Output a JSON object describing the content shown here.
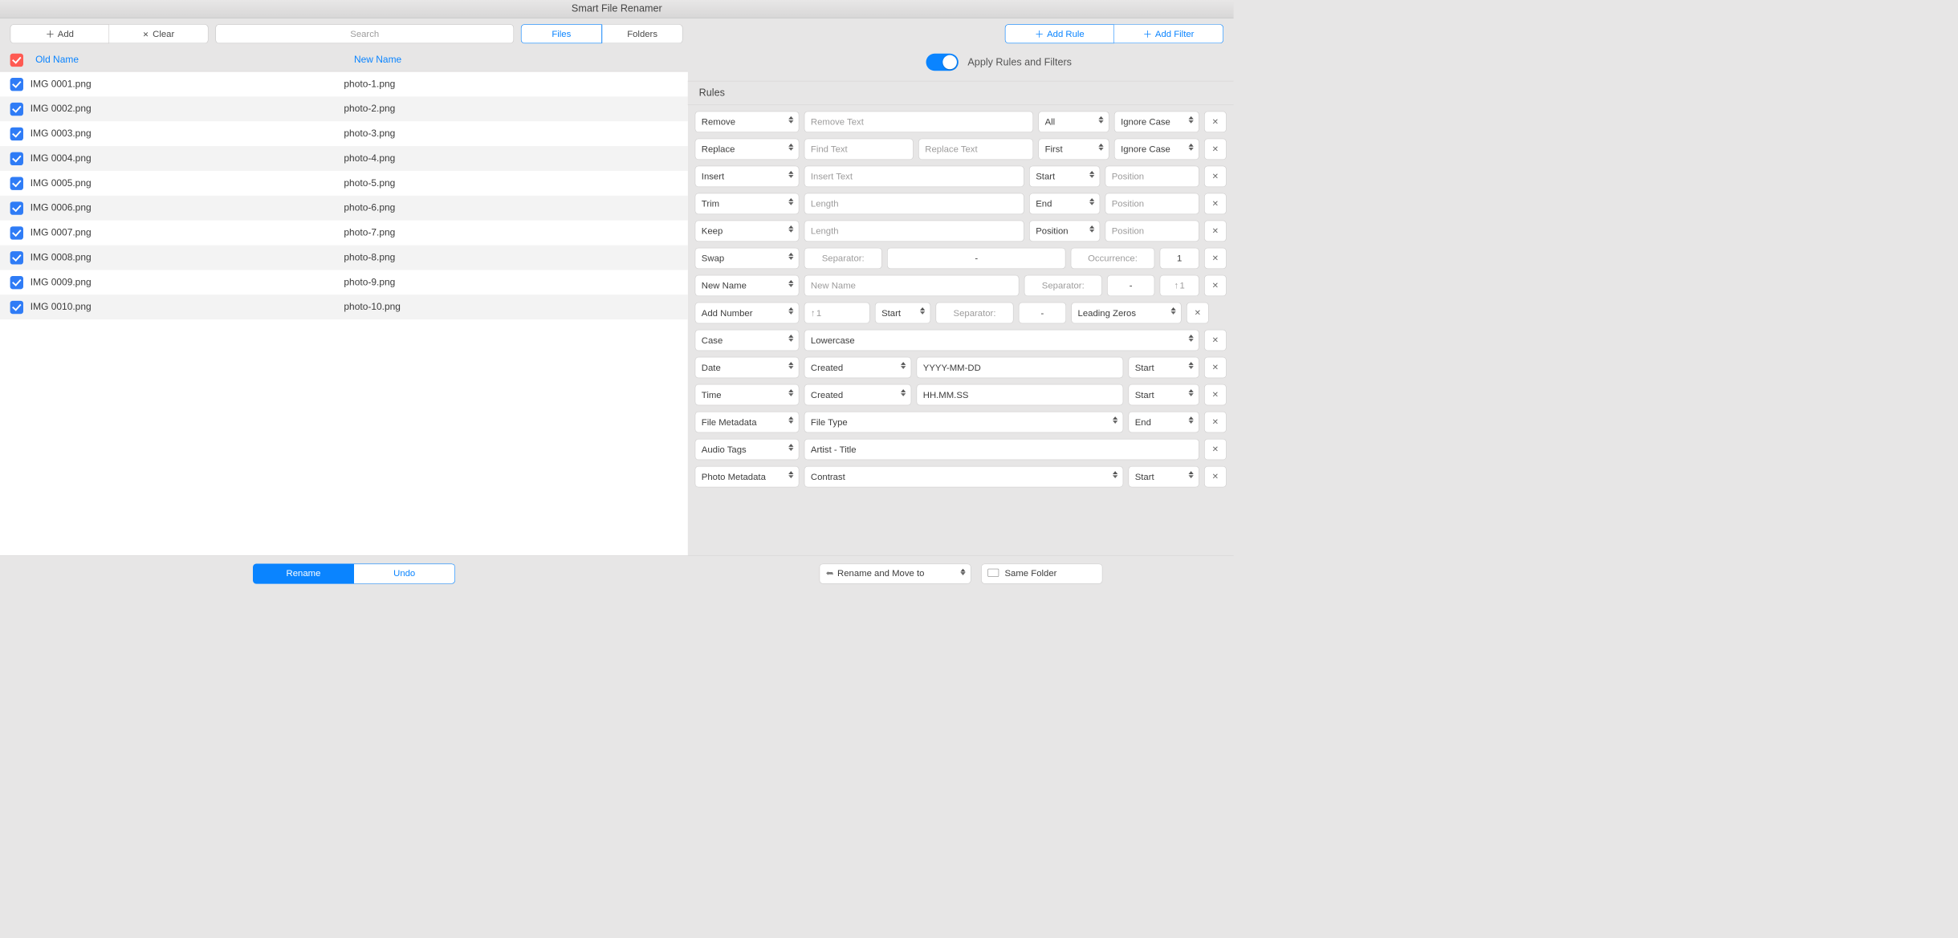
{
  "title": "Smart File Renamer",
  "toolbar": {
    "add": "Add",
    "clear": "Clear",
    "search_placeholder": "Search",
    "files": "Files",
    "folders": "Folders",
    "add_rule": "Add Rule",
    "add_filter": "Add Filter"
  },
  "apply_label": "Apply Rules and Filters",
  "table": {
    "old_header": "Old Name",
    "new_header": "New Name",
    "rows": [
      {
        "old": "IMG 0001.png",
        "new": "photo-1.png"
      },
      {
        "old": "IMG 0002.png",
        "new": "photo-2.png"
      },
      {
        "old": "IMG 0003.png",
        "new": "photo-3.png"
      },
      {
        "old": "IMG 0004.png",
        "new": "photo-4.png"
      },
      {
        "old": "IMG 0005.png",
        "new": "photo-5.png"
      },
      {
        "old": "IMG 0006.png",
        "new": "photo-6.png"
      },
      {
        "old": "IMG 0007.png",
        "new": "photo-7.png"
      },
      {
        "old": "IMG 0008.png",
        "new": "photo-8.png"
      },
      {
        "old": "IMG 0009.png",
        "new": "photo-9.png"
      },
      {
        "old": "IMG 0010.png",
        "new": "photo-10.png"
      }
    ]
  },
  "rules_header": "Rules",
  "rules": {
    "remove": {
      "action": "Remove",
      "ph": "Remove Text",
      "scope": "All",
      "case": "Ignore Case"
    },
    "replace": {
      "action": "Replace",
      "find_ph": "Find Text",
      "repl_ph": "Replace Text",
      "scope": "First",
      "case": "Ignore Case"
    },
    "insert": {
      "action": "Insert",
      "ph": "Insert Text",
      "at": "Start",
      "pos_ph": "Position"
    },
    "trim": {
      "action": "Trim",
      "ph": "Length",
      "at": "End",
      "pos_ph": "Position"
    },
    "keep": {
      "action": "Keep",
      "ph": "Length",
      "at": "Position",
      "pos_ph": "Position"
    },
    "swap": {
      "action": "Swap",
      "sep_lbl": "Separator:",
      "dash": "-",
      "occ_lbl": "Occurrence:",
      "occ_val": "1"
    },
    "newname": {
      "action": "New Name",
      "ph": "New Name",
      "sep_lbl": "Separator:",
      "dash": "-",
      "seq": "1"
    },
    "addnum": {
      "action": "Add Number",
      "seq": "1",
      "at": "Start",
      "sep_lbl": "Separator:",
      "dash": "-",
      "lz": "Leading Zeros"
    },
    "casec": {
      "action": "Case",
      "mode": "Lowercase"
    },
    "date": {
      "action": "Date",
      "src": "Created",
      "fmt": "YYYY-MM-DD",
      "at": "Start"
    },
    "time": {
      "action": "Time",
      "src": "Created",
      "fmt": "HH.MM.SS",
      "at": "Start"
    },
    "fmeta": {
      "action": "File Metadata",
      "field": "File Type",
      "at": "End"
    },
    "atags": {
      "action": "Audio Tags",
      "fmt": "Artist - Title"
    },
    "pmeta": {
      "action": "Photo Metadata",
      "field": "Contrast",
      "at": "Start"
    }
  },
  "footer": {
    "rename": "Rename",
    "undo": "Undo",
    "move": "Rename and Move to",
    "folder": "Same Folder"
  }
}
